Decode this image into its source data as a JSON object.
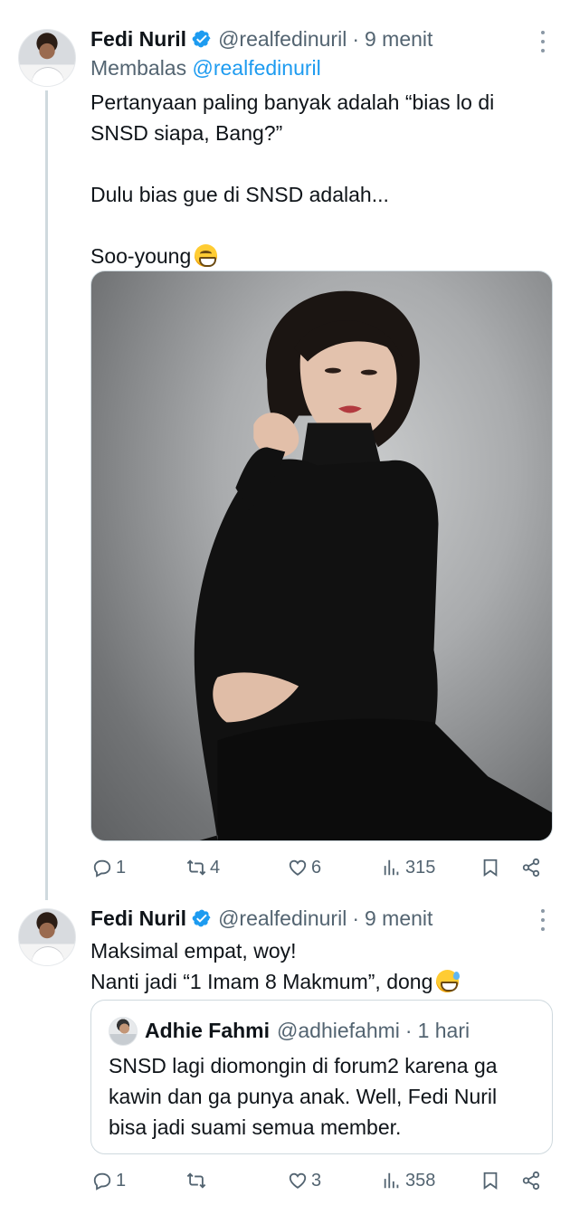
{
  "tweets": [
    {
      "name": "Fedi Nuril",
      "handle": "@realfedinuril",
      "separator": "·",
      "time": "9 menit",
      "reply_label": "Membalas",
      "reply_handle": "@realfedinuril",
      "lines": [
        "Pertanyaan paling banyak adalah “bias lo di",
        "SNSD siapa, Bang?”",
        "",
        "Dulu bias gue di SNSD adalah...",
        "",
        "Soo-young"
      ],
      "emoji": "grinning-face-with-smiling-eyes",
      "media": "photo-woman-black-turtleneck",
      "stats": {
        "replies": "1",
        "reposts": "4",
        "likes": "6",
        "views": "315"
      }
    },
    {
      "name": "Fedi Nuril",
      "handle": "@realfedinuril",
      "separator": "·",
      "time": "9 menit",
      "lines": [
        "Maksimal empat, woy!",
        "Nanti jadi “1 Imam 8 Makmum”, dong"
      ],
      "emoji": "grinning-face-with-sweat",
      "quote": {
        "name": "Adhie Fahmi",
        "handle": "@adhiefahmi",
        "separator": "·",
        "time": "1 hari",
        "lines": [
          "SNSD lagi diomongin di forum2 karena ga",
          "kawin dan ga punya anak. Well, Fedi Nuril",
          "bisa jadi suami semua member."
        ]
      },
      "stats": {
        "replies": "1",
        "reposts": "",
        "likes": "3",
        "views": "358"
      }
    }
  ],
  "colors": {
    "accent": "#1d9bf0",
    "text": "#0f1419",
    "muted": "#536471",
    "border": "#cfd9de"
  }
}
